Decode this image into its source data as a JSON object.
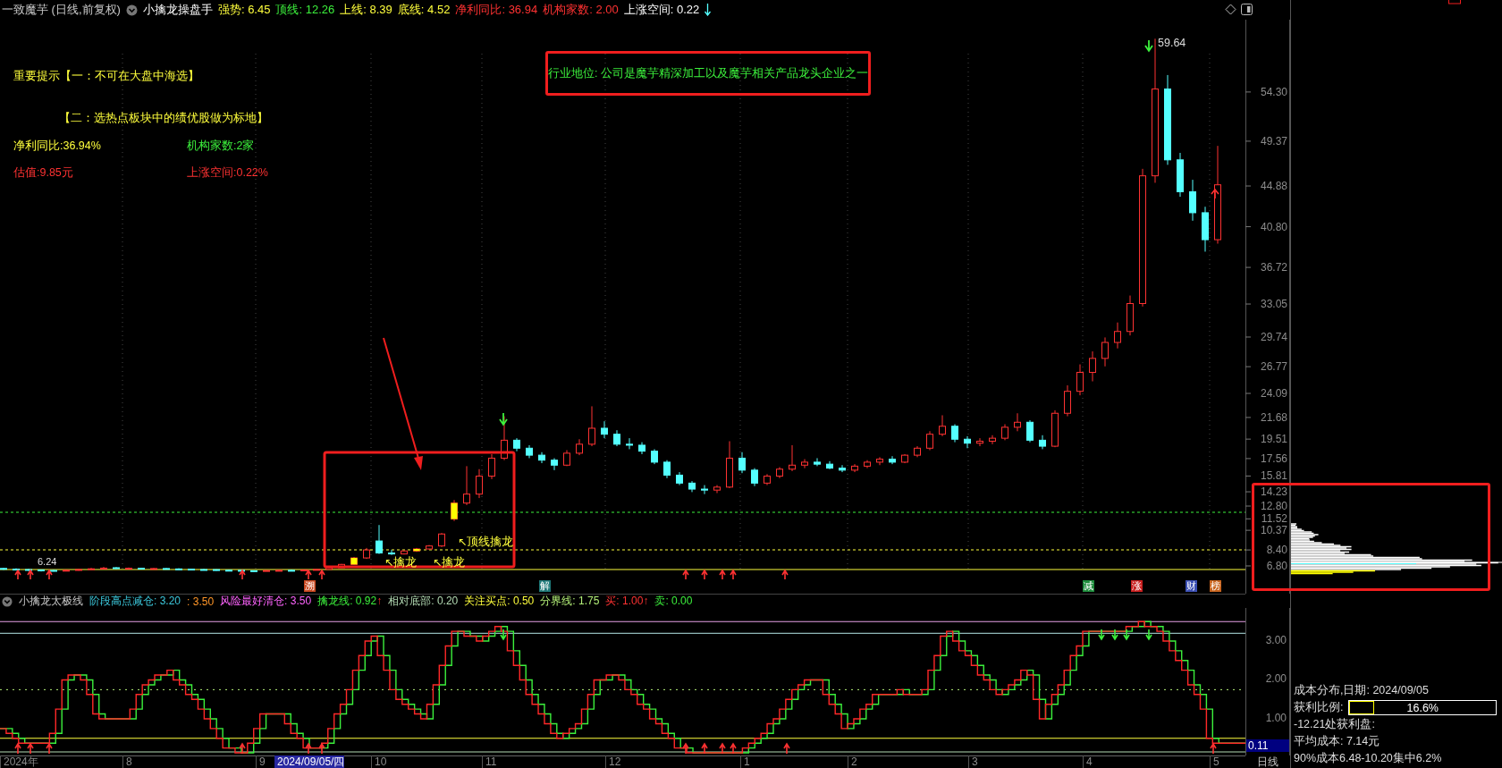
{
  "header": {
    "title": "一致魔芋 (日线,前复权)",
    "indicator": "小擒龙操盘手",
    "stats": [
      {
        "label": "强势:",
        "value": "6.45",
        "color": "#ffff3c"
      },
      {
        "label": "顶线:",
        "value": "12.26",
        "color": "#3cf03c"
      },
      {
        "label": "上线:",
        "value": "8.39",
        "color": "#ffff3c"
      },
      {
        "label": "底线:",
        "value": "4.52",
        "color": "#ffff3c"
      },
      {
        "label": "净利同比:",
        "value": "36.94",
        "color": "#ff3232"
      },
      {
        "label": "机构家数:",
        "value": "2.00",
        "color": "#ff3232"
      },
      {
        "label": "上涨空间:",
        "value": "0.22",
        "color": "#ffffff"
      }
    ]
  },
  "notes": [
    {
      "text": "重要提示【一：不可在大盘中海选】",
      "color": "#ffff3c"
    },
    {
      "text": "【二：选热点板块中的绩优股做为标地】",
      "color": "#ffff3c"
    },
    {
      "text": "净利同比:36.94%",
      "color": "#ffff3c"
    },
    {
      "text": "机构家数:2家",
      "color": "#3cf03c"
    },
    {
      "text": "估值:9.85元",
      "color": "#ff3232"
    },
    {
      "text": "上涨空间:0.22%",
      "color": "#ff3232"
    }
  ],
  "callout": {
    "text": "行业地位: 公司是魔芋精深加工以及魔芋相关产品龙头企业之一"
  },
  "price_chart": {
    "chart_data": {
      "type": "candlestick",
      "ylim": [
        4.02,
        61.55
      ],
      "ohlc": [
        [
          6.55,
          6.6,
          6.4,
          6.48
        ],
        [
          6.48,
          6.56,
          6.38,
          6.44
        ],
        [
          6.44,
          6.5,
          6.3,
          6.4
        ],
        [
          6.4,
          6.42,
          6.24,
          6.35
        ],
        [
          6.35,
          6.4,
          6.24,
          6.3
        ],
        [
          6.3,
          6.45,
          6.28,
          6.37
        ],
        [
          6.37,
          6.52,
          6.33,
          6.44
        ],
        [
          6.44,
          6.6,
          6.4,
          6.51
        ],
        [
          6.51,
          6.7,
          6.45,
          6.58
        ],
        [
          6.62,
          6.68,
          6.5,
          6.55
        ],
        [
          6.55,
          6.64,
          6.48,
          6.57
        ],
        [
          6.57,
          6.62,
          6.46,
          6.52
        ],
        [
          6.52,
          6.6,
          6.45,
          6.54
        ],
        [
          6.54,
          6.58,
          6.44,
          6.5
        ],
        [
          6.5,
          6.56,
          6.42,
          6.48
        ],
        [
          6.48,
          6.52,
          6.38,
          6.44
        ],
        [
          6.44,
          6.5,
          6.36,
          6.43
        ],
        [
          6.43,
          6.46,
          6.32,
          6.37
        ],
        [
          6.37,
          6.42,
          6.3,
          6.36
        ],
        [
          6.36,
          6.4,
          6.26,
          6.32
        ],
        [
          6.32,
          6.35,
          6.24,
          6.3
        ],
        [
          6.3,
          6.38,
          6.26,
          6.34
        ],
        [
          6.34,
          6.4,
          6.3,
          6.36
        ],
        [
          6.36,
          6.42,
          6.3,
          6.35
        ],
        [
          6.35,
          6.45,
          6.32,
          6.4
        ],
        [
          6.4,
          6.5,
          6.36,
          6.45
        ],
        [
          6.45,
          6.7,
          6.42,
          6.62
        ],
        [
          6.62,
          7.0,
          6.6,
          6.95
        ],
        [
          6.95,
          7.7,
          6.9,
          7.6
        ],
        [
          7.6,
          8.6,
          7.5,
          8.4
        ],
        [
          9.3,
          10.9,
          8.0,
          8.1
        ],
        [
          8.1,
          8.4,
          7.9,
          8.0
        ],
        [
          8.0,
          8.35,
          7.95,
          8.3
        ],
        [
          8.3,
          8.6,
          8.2,
          8.5
        ],
        [
          8.5,
          8.9,
          8.45,
          8.8
        ],
        [
          8.8,
          10.1,
          8.7,
          10.0
        ],
        [
          11.5,
          13.4,
          11.3,
          13.1
        ],
        [
          13.1,
          16.8,
          12.9,
          14.0
        ],
        [
          14.0,
          16.5,
          13.6,
          15.8
        ],
        [
          15.8,
          18.0,
          15.5,
          17.6
        ],
        [
          17.6,
          21.8,
          17.4,
          19.4
        ],
        [
          19.4,
          19.6,
          18.3,
          18.6
        ],
        [
          18.6,
          18.9,
          17.6,
          17.9
        ],
        [
          17.9,
          18.2,
          17.1,
          17.4
        ],
        [
          17.4,
          17.6,
          16.4,
          16.9
        ],
        [
          16.9,
          18.4,
          16.8,
          18.1
        ],
        [
          18.1,
          19.5,
          17.9,
          19.0
        ],
        [
          19.0,
          22.8,
          18.8,
          20.6
        ],
        [
          20.6,
          21.3,
          19.6,
          20.0
        ],
        [
          20.0,
          20.4,
          18.8,
          19.0
        ],
        [
          19.0,
          19.6,
          18.5,
          18.9
        ],
        [
          18.9,
          19.2,
          18.0,
          18.3
        ],
        [
          18.3,
          18.5,
          17.0,
          17.2
        ],
        [
          17.2,
          17.4,
          15.6,
          15.9
        ],
        [
          15.9,
          16.2,
          14.9,
          15.1
        ],
        [
          15.1,
          15.3,
          14.2,
          14.5
        ],
        [
          14.5,
          14.9,
          14.0,
          14.4
        ],
        [
          14.4,
          14.9,
          14.1,
          14.7
        ],
        [
          14.7,
          19.3,
          14.6,
          17.6
        ],
        [
          17.6,
          18.2,
          16.1,
          16.4
        ],
        [
          16.4,
          16.6,
          14.8,
          15.1
        ],
        [
          15.1,
          16.0,
          14.9,
          15.8
        ],
        [
          15.8,
          16.7,
          15.6,
          16.5
        ],
        [
          16.5,
          18.9,
          16.3,
          16.9
        ],
        [
          16.9,
          17.5,
          16.6,
          17.2
        ],
        [
          17.2,
          17.6,
          16.8,
          17.0
        ],
        [
          17.0,
          17.3,
          16.5,
          16.6
        ],
        [
          16.6,
          16.9,
          16.2,
          16.4
        ],
        [
          16.4,
          17.0,
          16.2,
          16.8
        ],
        [
          16.8,
          17.4,
          16.6,
          17.2
        ],
        [
          17.2,
          17.7,
          16.9,
          17.5
        ],
        [
          17.5,
          17.8,
          17.0,
          17.2
        ],
        [
          17.2,
          18.0,
          17.1,
          17.9
        ],
        [
          17.9,
          18.8,
          17.7,
          18.6
        ],
        [
          18.6,
          20.3,
          18.4,
          20.0
        ],
        [
          20.0,
          21.9,
          19.8,
          20.8
        ],
        [
          20.8,
          21.0,
          19.2,
          19.5
        ],
        [
          19.5,
          19.8,
          18.6,
          19.1
        ],
        [
          19.1,
          19.6,
          18.8,
          19.3
        ],
        [
          19.3,
          19.9,
          19.0,
          19.6
        ],
        [
          19.6,
          21.0,
          19.4,
          20.7
        ],
        [
          20.7,
          22.1,
          20.3,
          21.2
        ],
        [
          21.2,
          21.4,
          19.2,
          19.4
        ],
        [
          19.4,
          19.9,
          18.5,
          18.8
        ],
        [
          18.8,
          22.4,
          18.7,
          22.1
        ],
        [
          22.1,
          24.9,
          21.8,
          24.3
        ],
        [
          24.3,
          27.0,
          23.9,
          26.2
        ],
        [
          26.2,
          28.3,
          25.3,
          27.6
        ],
        [
          27.6,
          29.7,
          26.8,
          29.2
        ],
        [
          29.2,
          31.2,
          28.6,
          30.3
        ],
        [
          30.3,
          33.9,
          29.9,
          33.1
        ],
        [
          33.1,
          46.6,
          32.8,
          45.9
        ],
        [
          45.9,
          59.64,
          45.2,
          54.6
        ],
        [
          54.6,
          56.0,
          47.0,
          47.5
        ],
        [
          47.5,
          48.2,
          43.8,
          44.3
        ],
        [
          44.3,
          45.5,
          41.4,
          42.2
        ],
        [
          42.2,
          42.8,
          38.3,
          39.5
        ],
        [
          39.5,
          48.9,
          39.1,
          45.0
        ]
      ],
      "yticks": [
        {
          "value": 54.3,
          "label": "54.30"
        },
        {
          "value": 49.37,
          "label": "49.37"
        },
        {
          "value": 44.88,
          "label": "44.88"
        },
        {
          "value": 40.8,
          "label": "40.80"
        },
        {
          "value": 36.72,
          "label": "36.72"
        },
        {
          "value": 33.05,
          "label": "33.05"
        },
        {
          "value": 29.74,
          "label": "29.74"
        },
        {
          "value": 26.77,
          "label": "26.77"
        },
        {
          "value": 24.09,
          "label": "24.09"
        },
        {
          "value": 21.68,
          "label": "21.68"
        },
        {
          "value": 19.51,
          "label": "19.51"
        },
        {
          "value": 17.56,
          "label": "17.56"
        },
        {
          "value": 15.81,
          "label": "15.81"
        },
        {
          "value": 14.23,
          "label": "14.23"
        },
        {
          "value": 12.8,
          "label": "12.80"
        },
        {
          "value": 11.52,
          "label": "11.52"
        },
        {
          "value": 10.37,
          "label": "10.37"
        },
        {
          "value": 8.4,
          "label": "8.40"
        },
        {
          "value": 6.8,
          "label": "6.80"
        }
      ]
    }
  },
  "chart_labels": {
    "peak": "59.64",
    "low": "6.24",
    "annotations": [
      "↖擒龙",
      "↖擒龙",
      "↖顶线擒龙"
    ]
  },
  "event_tags": [
    {
      "label": "溯",
      "color": "#c8461e"
    },
    {
      "label": "解",
      "color": "#1e7878"
    },
    {
      "label": "减",
      "color": "#1e8c3c"
    },
    {
      "label": "涨",
      "color": "#c81e1e"
    },
    {
      "label": "财",
      "color": "#3c50b4"
    },
    {
      "label": "榜",
      "color": "#c8641e"
    }
  ],
  "lower_indicator": {
    "name": "小擒龙太极线",
    "stats": [
      {
        "label": "阶段高点减仓:",
        "value": "3.20",
        "color": "#3cc8dc"
      },
      {
        "label": ":",
        "value": "3.50",
        "color": "#ff9628"
      },
      {
        "label": "风险最好清仓:",
        "value": "3.50",
        "color": "#ff64ff"
      },
      {
        "label": "擒龙线:",
        "value": "0.92",
        "color": "#3cf03c",
        "arrow": "↑"
      },
      {
        "label": "相对底部:",
        "value": "0.20",
        "color": "#b4dcb4"
      },
      {
        "label": "关注买点:",
        "value": "0.50",
        "color": "#ffff3c"
      },
      {
        "label": "分界线:",
        "value": "1.75",
        "color": "#b4f078"
      },
      {
        "label": "买:",
        "value": "1.00",
        "color": "#ff3232",
        "arrow": "↑"
      },
      {
        "label": "卖:",
        "value": "0.00",
        "color": "#3cf03c"
      }
    ]
  },
  "lower_axis": [
    "3.00",
    "2.00",
    "1.00"
  ],
  "current_value": "0.11",
  "x_axis": [
    {
      "label": "2024年",
      "kind": "tick"
    },
    {
      "label": "8",
      "kind": "tick"
    },
    {
      "label": "9",
      "kind": "tick"
    },
    {
      "label": "2024/09/05/四",
      "kind": "cursor"
    },
    {
      "label": "10",
      "kind": "tick"
    },
    {
      "label": "11",
      "kind": "tick"
    },
    {
      "label": "12",
      "kind": "tick"
    },
    {
      "label": "1",
      "kind": "tick"
    },
    {
      "label": "2",
      "kind": "tick"
    },
    {
      "label": "3",
      "kind": "tick"
    },
    {
      "label": "4",
      "kind": "tick"
    },
    {
      "label": "5",
      "kind": "tick"
    }
  ],
  "period": "日线",
  "cost_panel": {
    "date_line": "成本分布,日期:  2024/09/05",
    "profit_ratio": {
      "label": "获利比例:",
      "level": 0.166,
      "reading": "16.6%"
    },
    "lines": [
      "-12.21处获利盘:",
      "平均成本:  7.14元",
      "90%成本6.48-10.20集中6.2%"
    ]
  }
}
